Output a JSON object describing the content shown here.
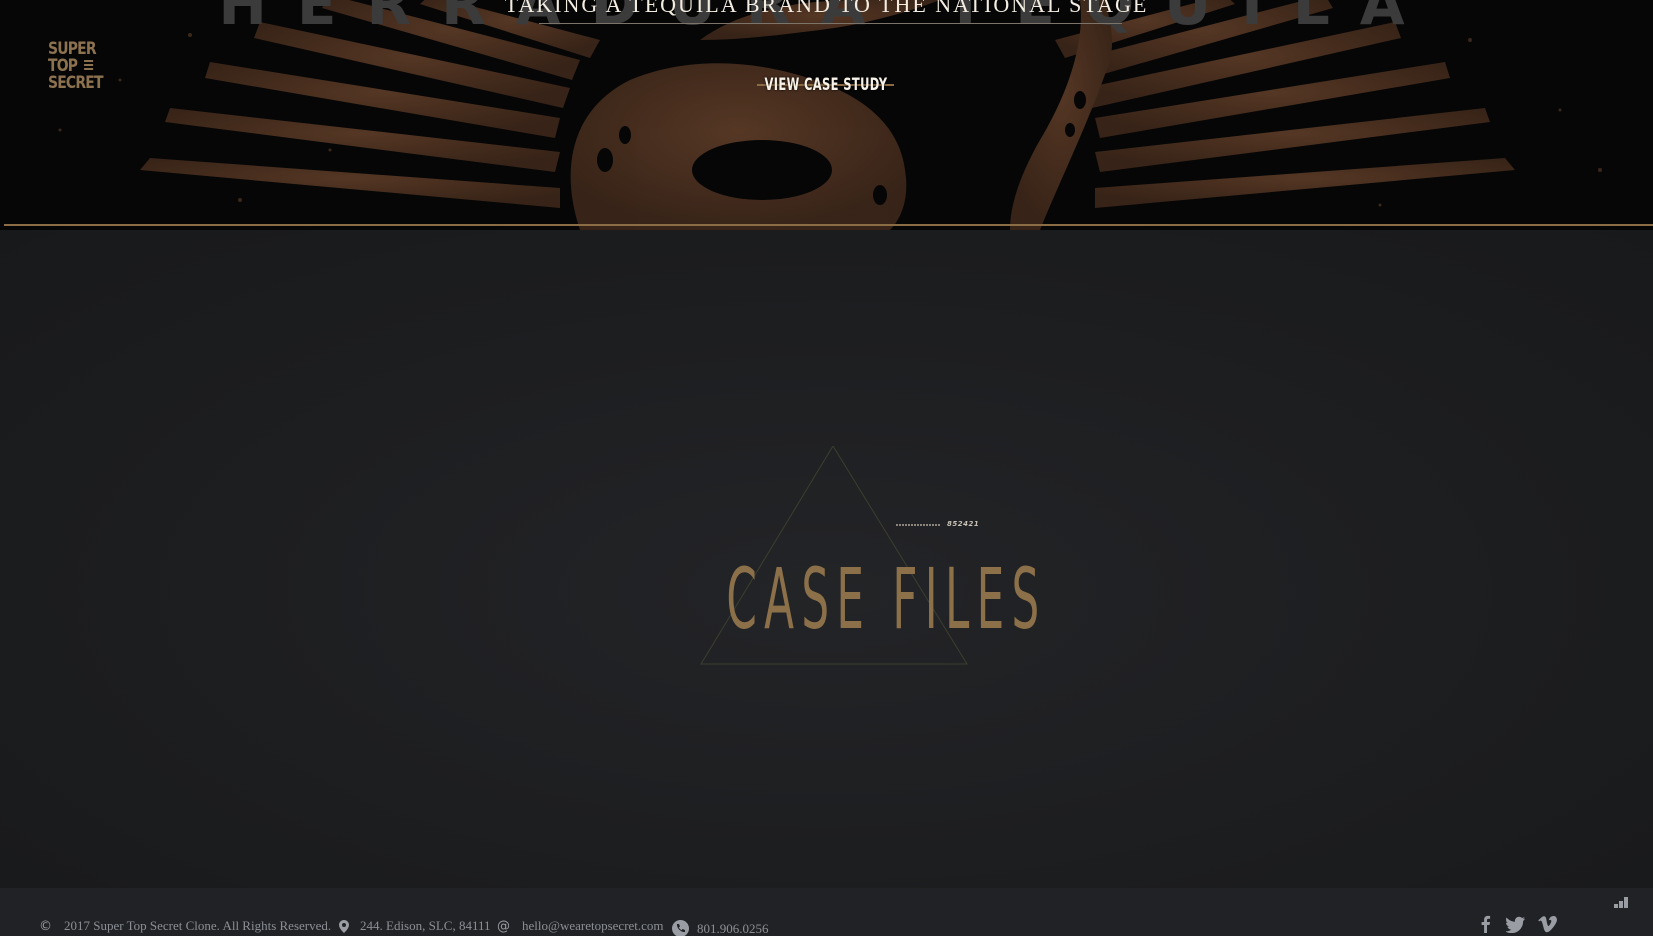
{
  "logo": {
    "line1": "SUPER",
    "line2": "TOP",
    "line3": "SECRET"
  },
  "hero": {
    "ghost_title": "HERRADURA TEQUILA",
    "tagline": "TAKING A TEQUILA BRAND TO THE NATIONAL STAGE",
    "cta_label": "VIEW CASE STUDY"
  },
  "case_files": {
    "title": "CASE FILES",
    "code": "852421"
  },
  "footer": {
    "copyright": "2017 Super Top Secret Clone. All Rights Reserved.",
    "address": "244. Edison, SLC, 84111",
    "email": "hello@wearetopsecret.com",
    "phone": "801.906.0256"
  },
  "icons": {
    "copyright": "copyright-icon",
    "address": "map-pin-icon",
    "email": "at-icon",
    "phone": "phone-icon",
    "social": [
      "facebook-icon",
      "twitter-icon",
      "vimeo-icon"
    ]
  },
  "colors": {
    "accent_gold": "#8c7049",
    "hero_bg": "#060606",
    "main_bg": "#1c1d1f",
    "footer_bg": "#212225"
  }
}
